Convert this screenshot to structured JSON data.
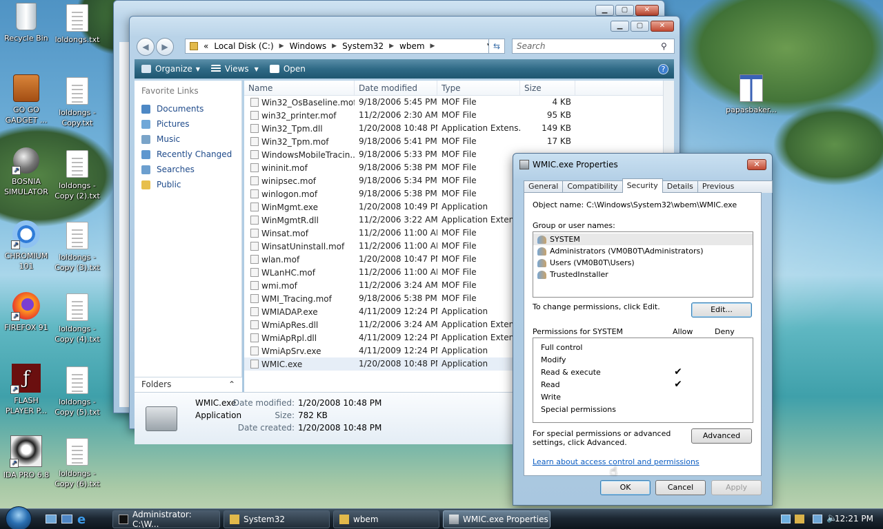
{
  "desktop": {
    "icons": [
      {
        "label": "Recycle Bin"
      },
      {
        "label": "loldongs.txt"
      },
      {
        "label": "GO GO GADGET ..."
      },
      {
        "label": "loldongs - Copy.txt"
      },
      {
        "label": "BOSNIA SIMULATOR"
      },
      {
        "label": "loldongs - Copy (2).txt"
      },
      {
        "label": "CHROMIUM 101"
      },
      {
        "label": "loldongs - Copy (3).txt"
      },
      {
        "label": "FIREFOX 91"
      },
      {
        "label": "loldongs - Copy (4).txt"
      },
      {
        "label": "FLASH PLAYER P..."
      },
      {
        "label": "loldongs - Copy (5).txt"
      },
      {
        "label": "IDA PRO 6.8"
      },
      {
        "label": "loldongs - Copy (6).txt"
      },
      {
        "label": "papasbaker..."
      }
    ]
  },
  "explorer": {
    "breadcrumb": {
      "prefix": "«",
      "parts": [
        "Local Disk (C:)",
        "Windows",
        "System32",
        "wbem"
      ]
    },
    "search_placeholder": "Search",
    "toolbar": {
      "organize": "Organize",
      "views": "Views",
      "open": "Open"
    },
    "nav": {
      "header": "Favorite Links",
      "items": [
        "Documents",
        "Pictures",
        "Music",
        "Recently Changed",
        "Searches",
        "Public"
      ],
      "folders": "Folders"
    },
    "columns": {
      "name": "Name",
      "date": "Date modified",
      "type": "Type",
      "size": "Size"
    },
    "files": [
      {
        "name": "Win32_OsBaseline.mof",
        "date": "9/18/2006 5:45 PM",
        "type": "MOF File",
        "size": "4 KB"
      },
      {
        "name": "win32_printer.mof",
        "date": "11/2/2006 2:30 AM",
        "type": "MOF File",
        "size": "95 KB"
      },
      {
        "name": "Win32_Tpm.dll",
        "date": "1/20/2008 10:48 PM",
        "type": "Application Extens...",
        "size": "149 KB"
      },
      {
        "name": "Win32_Tpm.mof",
        "date": "9/18/2006 5:41 PM",
        "type": "MOF File",
        "size": "17 KB"
      },
      {
        "name": "WindowsMobileTracin...",
        "date": "9/18/2006 5:33 PM",
        "type": "MOF File",
        "size": ""
      },
      {
        "name": "wininit.mof",
        "date": "9/18/2006 5:38 PM",
        "type": "MOF File",
        "size": ""
      },
      {
        "name": "winipsec.mof",
        "date": "9/18/2006 5:34 PM",
        "type": "MOF File",
        "size": ""
      },
      {
        "name": "winlogon.mof",
        "date": "9/18/2006 5:38 PM",
        "type": "MOF File",
        "size": ""
      },
      {
        "name": "WinMgmt.exe",
        "date": "1/20/2008 10:49 PM",
        "type": "Application",
        "size": ""
      },
      {
        "name": "WinMgmtR.dll",
        "date": "11/2/2006 3:22 AM",
        "type": "Application Extens...",
        "size": ""
      },
      {
        "name": "Winsat.mof",
        "date": "11/2/2006 11:00 AM",
        "type": "MOF File",
        "size": ""
      },
      {
        "name": "WinsatUninstall.mof",
        "date": "11/2/2006 11:00 AM",
        "type": "MOF File",
        "size": ""
      },
      {
        "name": "wlan.mof",
        "date": "1/20/2008 10:47 PM",
        "type": "MOF File",
        "size": ""
      },
      {
        "name": "WLanHC.mof",
        "date": "11/2/2006 11:00 AM",
        "type": "MOF File",
        "size": ""
      },
      {
        "name": "wmi.mof",
        "date": "11/2/2006 3:24 AM",
        "type": "MOF File",
        "size": ""
      },
      {
        "name": "WMI_Tracing.mof",
        "date": "9/18/2006 5:38 PM",
        "type": "MOF File",
        "size": ""
      },
      {
        "name": "WMIADAP.exe",
        "date": "4/11/2009 12:24 PM",
        "type": "Application",
        "size": ""
      },
      {
        "name": "WmiApRes.dll",
        "date": "11/2/2006 3:24 AM",
        "type": "Application Extens...",
        "size": ""
      },
      {
        "name": "WmiApRpl.dll",
        "date": "4/11/2009 12:24 PM",
        "type": "Application Extens...",
        "size": ""
      },
      {
        "name": "WmiApSrv.exe",
        "date": "4/11/2009 12:24 PM",
        "type": "Application",
        "size": ""
      },
      {
        "name": "WMIC.exe",
        "date": "1/20/2008 10:48 PM",
        "type": "Application",
        "size": ""
      }
    ],
    "details": {
      "name": "WMIC.exe",
      "type": "Application",
      "modified_label": "Date modified:",
      "modified": "1/20/2008 10:48 PM",
      "size_label": "Size:",
      "size": "782 KB",
      "created_label": "Date created:",
      "created": "1/20/2008 10:48 PM"
    }
  },
  "dialog": {
    "title": "WMIC.exe Properties",
    "tabs": [
      "General",
      "Compatibility",
      "Security",
      "Details",
      "Previous Versions"
    ],
    "object_label": "Object name:",
    "object_value": "C:\\Windows\\System32\\wbem\\WMIC.exe",
    "group_label": "Group or user names:",
    "users": [
      "SYSTEM",
      "Administrators (VM0B0T\\Administrators)",
      "Users (VM0B0T\\Users)",
      "TrustedInstaller"
    ],
    "change_text": "To change permissions, click Edit.",
    "edit_btn": "Edit...",
    "perm_header": "Permissions for SYSTEM",
    "allow": "Allow",
    "deny": "Deny",
    "permissions": [
      {
        "name": "Full control",
        "allow": "",
        "deny": ""
      },
      {
        "name": "Modify",
        "allow": "",
        "deny": ""
      },
      {
        "name": "Read & execute",
        "allow": "✔",
        "deny": ""
      },
      {
        "name": "Read",
        "allow": "✔",
        "deny": ""
      },
      {
        "name": "Write",
        "allow": "",
        "deny": ""
      },
      {
        "name": "Special permissions",
        "allow": "",
        "deny": ""
      }
    ],
    "special_text": "For special permissions or advanced settings, click Advanced.",
    "advanced_btn": "Advanced",
    "learn_link": "Learn about access control and permissions",
    "ok": "OK",
    "cancel": "Cancel",
    "apply": "Apply"
  },
  "taskbar": {
    "tasks": [
      "Administrator: C:\\W...",
      "System32",
      "wbem",
      "WMIC.exe Properties"
    ],
    "clock": "12:21 PM"
  }
}
